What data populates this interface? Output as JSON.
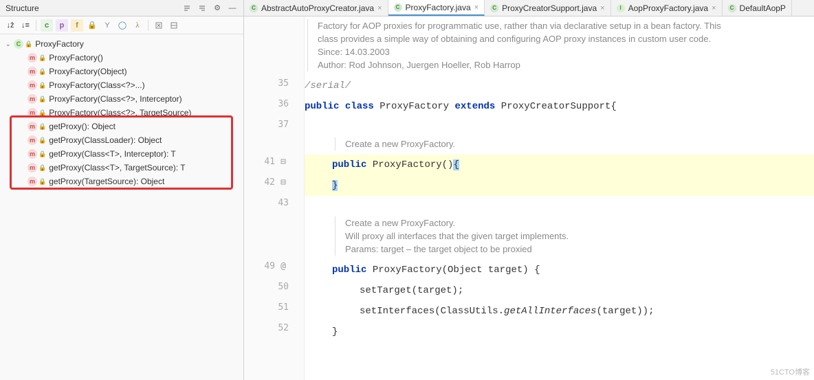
{
  "panel": {
    "title": "Structure"
  },
  "structure": {
    "root": "ProxyFactory",
    "items": [
      {
        "badge": "m",
        "label": "ProxyFactory()"
      },
      {
        "badge": "m",
        "label": "ProxyFactory(Object)"
      },
      {
        "badge": "m",
        "label": "ProxyFactory(Class<?>...)"
      },
      {
        "badge": "m",
        "label": "ProxyFactory(Class<?>, Interceptor)"
      },
      {
        "badge": "m",
        "label": "ProxyFactory(Class<?>, TargetSource)"
      },
      {
        "badge": "m",
        "label": "getProxy(): Object"
      },
      {
        "badge": "m",
        "label": "getProxy(ClassLoader): Object"
      },
      {
        "badge": "m",
        "label": "getProxy(Class<T>, Interceptor): T"
      },
      {
        "badge": "m",
        "label": "getProxy(Class<T>, TargetSource): T"
      },
      {
        "badge": "m",
        "label": "getProxy(TargetSource): Object"
      }
    ]
  },
  "tabs": [
    {
      "icon": "C",
      "label": "AbstractAutoProxyCreator.java",
      "active": false
    },
    {
      "icon": "C",
      "label": "ProxyFactory.java",
      "active": true
    },
    {
      "icon": "C",
      "label": "ProxyCreatorSupport.java",
      "active": false
    },
    {
      "icon": "I",
      "label": "AopProxyFactory.java",
      "active": false
    },
    {
      "icon": "C",
      "label": "DefaultAopP",
      "active": false
    }
  ],
  "doc1": {
    "l1": "Factory for AOP proxies for programmatic use, rather than via declarative setup in a bean factory. This",
    "l2": "class provides a simple way of obtaining and configuring AOP proxy instances in custom user code.",
    "l3": "Since:   14.03.2003",
    "l4": "Author: Rod Johnson, Juergen Hoeller, Rob Harrop"
  },
  "doc2": {
    "l1": "Create a new ProxyFactory."
  },
  "doc3": {
    "l1": "Create a new ProxyFactory.",
    "l2": "Will proxy all interfaces that the given target implements.",
    "l3": "Params: target – the target object to be proxied"
  },
  "code": {
    "lnum35": "35",
    "l35": "/serial/",
    "lnum36": "36",
    "l36_kw1": "public",
    "l36_kw2": "class",
    "l36_name": "ProxyFactory",
    "l36_kw3": "extends",
    "l36_ext": "ProxyCreatorSupport",
    "l36_tail": " {",
    "lnum37": "37",
    "lnum41": "41",
    "l41_kw": "public",
    "l41_name": "ProxyFactory",
    "l41_tail": "() ",
    "l41_brace": "{",
    "lnum42": "42",
    "l42_brace": "}",
    "lnum43": "43",
    "lnum49": "49",
    "ann49": "@",
    "l49_kw": "public",
    "l49_name": "ProxyFactory",
    "l49_tail": "(Object target) {",
    "lnum50": "50",
    "l50": "setTarget(target);",
    "lnum51": "51",
    "l51a": "setInterfaces(ClassUtils.",
    "l51b": "getAllInterfaces",
    "l51c": "(target));",
    "lnum52": "52",
    "l52": "}"
  },
  "watermark": "51CTO博客"
}
